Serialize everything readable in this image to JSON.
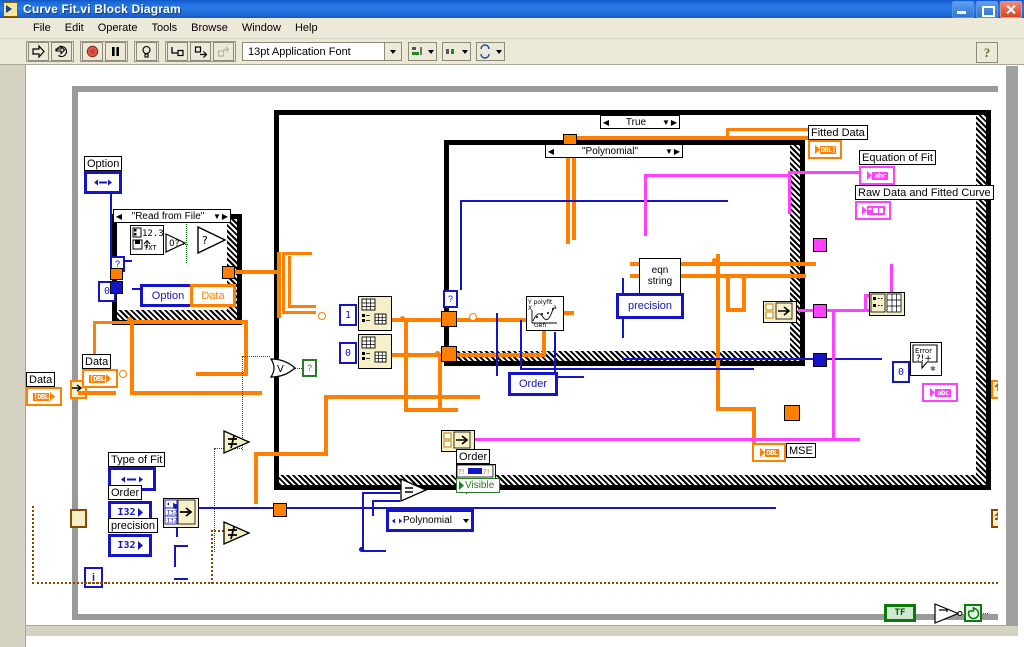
{
  "window": {
    "title": "Curve Fit.vi Block Diagram",
    "icon": "labview-vi-icon",
    "buttons": {
      "minimize": "minimize-button",
      "maximize": "maximize-button",
      "close": "close-button"
    }
  },
  "menu": {
    "items": [
      "File",
      "Edit",
      "Operate",
      "Tools",
      "Browse",
      "Window",
      "Help"
    ]
  },
  "toolbar": {
    "run": "run-arrow-icon",
    "run_continuously": "run-continuously-icon",
    "abort": "abort-execution-icon",
    "pause": "pause-icon",
    "highlight": "highlight-execution-bulb-icon",
    "step_into": "step-into-icon",
    "step_over": "step-over-icon",
    "step_out": "step-out-icon",
    "font": "13pt Application Font",
    "align": "align-objects-icon",
    "distribute": "distribute-objects-icon",
    "reorder": "reorder-icon",
    "help": "?"
  },
  "diagram": {
    "structures": {
      "while_loop_label": "while-loop",
      "iteration_terminal": "i",
      "case_read_from_file": "\"Read from File\"",
      "case_true": "True",
      "case_polynomial": "\"Polynomial\""
    },
    "controls": [
      {
        "name": "option-control",
        "label": "Option",
        "type": "enum"
      },
      {
        "name": "data-control-inner",
        "label": "Data",
        "type": "DBL"
      },
      {
        "name": "data-control-outer",
        "label": "Data",
        "type": "DBL"
      },
      {
        "name": "type-of-fit-control",
        "label": "Type of Fit",
        "type": "enum"
      },
      {
        "name": "order-control",
        "label": "Order",
        "type": "I32"
      },
      {
        "name": "precision-control",
        "label": "precision",
        "type": "I32"
      }
    ],
    "indicators": [
      {
        "name": "fitted-data-indicator",
        "label": "Fitted Data",
        "type": "DBL"
      },
      {
        "name": "equation-of-fit-indicator",
        "label": "Equation of Fit",
        "type": "abc"
      },
      {
        "name": "raw-data-and-fitted-curve-indicator",
        "label": "Raw Data and Fitted Curve",
        "type": "cluster"
      },
      {
        "name": "mse-indicator",
        "label": "MSE",
        "type": "DBL"
      },
      {
        "name": "error-string-indicator",
        "label": "",
        "type": "abc"
      }
    ],
    "locals": [
      {
        "name": "option-local",
        "label": "Option"
      },
      {
        "name": "data-local",
        "label": "Data"
      },
      {
        "name": "precision-local",
        "label": "precision"
      },
      {
        "name": "order-local",
        "label": "Order"
      }
    ],
    "subvis": [
      {
        "name": "read-from-spreadsheet-file-vi",
        "label": "12.3 TXT"
      },
      {
        "name": "general-polynomial-fit-vi",
        "label": "polyfit Gen"
      },
      {
        "name": "eqn-string-subvi",
        "label_line1": "eqn",
        "label_line2": "string"
      },
      {
        "name": "general-error-handler-vi",
        "label_line1": "Error",
        "label_line2": "?!+"
      }
    ],
    "property_node": {
      "name": "order-property-node",
      "reference": "Order",
      "property": "Visible"
    },
    "enum_constant": {
      "name": "polynomial-enum-constant",
      "value": "Polynomial"
    },
    "numeric_constants": [
      {
        "name": "index-constant-one",
        "value": "1"
      },
      {
        "name": "index-constant-zero-a",
        "value": "0"
      },
      {
        "name": "index-constant-zero-b",
        "value": "0"
      },
      {
        "name": "error-code-constant",
        "value": "0"
      }
    ],
    "boolean_control": {
      "name": "stop-boolean-control",
      "value": "TF"
    },
    "primitives": [
      {
        "name": "empty-array-test-node",
        "glyph": "0?"
      },
      {
        "name": "select-node-upper",
        "glyph": "?"
      },
      {
        "name": "or-node",
        "glyph": "V"
      },
      {
        "name": "not-equal-node-upper",
        "glyph": "≠"
      },
      {
        "name": "not-equal-node-lower",
        "glyph": "≠"
      },
      {
        "name": "equal-node",
        "glyph": "="
      },
      {
        "name": "not-node",
        "glyph": "¬"
      },
      {
        "name": "index-array-node-one",
        "glyph": "index-array"
      },
      {
        "name": "index-array-node-zero",
        "glyph": "index-array"
      },
      {
        "name": "bundle-node-left",
        "glyph": "bundle"
      },
      {
        "name": "bundle-node-right",
        "glyph": "bundle"
      },
      {
        "name": "build-array-node",
        "glyph": "build-array"
      },
      {
        "name": "loop-condition-terminal",
        "glyph": "continue-if-true"
      }
    ],
    "colors": {
      "wire_double": "#ff8000",
      "wire_integer": "#1414c8",
      "wire_string_cluster": "#ff40ff",
      "wire_boolean": "#007000",
      "wire_error": "#8b4800",
      "structure_border": "#9a9a9a",
      "node_fill": "#f5f0c8",
      "canvas": "#ffffff"
    }
  }
}
